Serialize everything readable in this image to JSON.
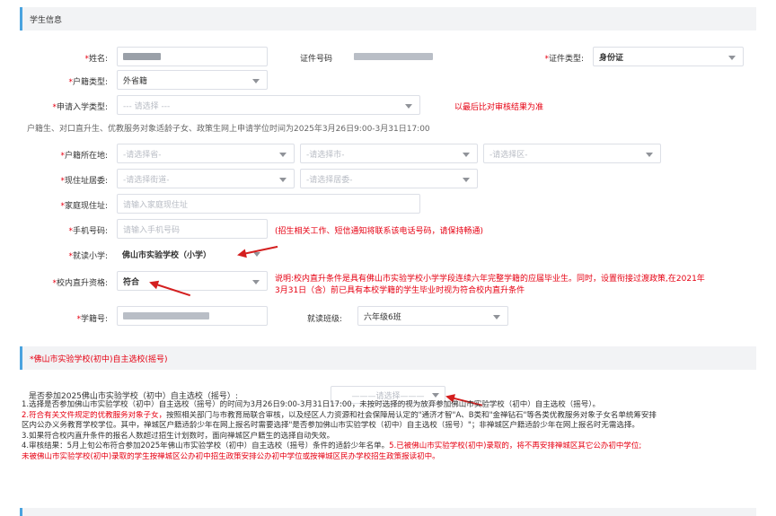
{
  "section1": {
    "title": "学生信息"
  },
  "fields": {
    "name_label": "姓名:",
    "id_no_label": "证件号码",
    "id_type_label": "证件类型:",
    "id_type_value": "身份证",
    "huji_label": "户籍类型:",
    "huji_value": "外省籍",
    "apply_type_label": "申请入学类型:",
    "apply_type_ph": "--- 请选择 ---",
    "apply_hint": "以最后比对审核结果为准",
    "apply_note": "户籍生、对口直升生、优教服务对象适龄子女、政策生网上申请学位时间为2025年3月26日9:00-3月31日17:00",
    "huji_loc_label": "户籍所在地:",
    "province_ph": "-请选择省-",
    "city_ph": "-请选择市-",
    "district_ph": "-请选择区-",
    "residence_label": "现住址居委:",
    "street_ph": "-请选择街道-",
    "committee_ph": "-请选择居委-",
    "address_label": "家庭现住址:",
    "address_ph": "请输入家庭现住址",
    "phone_label": "手机号码:",
    "phone_ph": "请输入手机号码",
    "phone_hint": "(招生相关工作、短信通知将联系该电话号码，请保持畅通)",
    "school_label": "就读小学:",
    "school_value": "佛山市实验学校（小学）",
    "direct_label": "校内直升资格:",
    "direct_value": "符合",
    "direct_hint1": "说明:校内直升条件是具有佛山市实验学校小学学段连续六年完整学籍的应届毕业生。同时，设置衔接过渡政策,在2021年",
    "direct_hint2": "3月31日（含）前已具有本校学籍的学生毕业时视为符合校内直升条件",
    "xueji_label": "学籍号:",
    "class_label": "就读班级:",
    "class_value": "六年级6班"
  },
  "section2": {
    "title": "*佛山市实验学校(初中)自主选校(摇号)",
    "question": "是否参加2025佛山市实验学校（初中）自主选校（摇号）:",
    "select_ph": "———请选择———"
  },
  "notes": {
    "n1": "1.选择是否参加佛山市实验学校（初中）自主选校（摇号）的时间为3月26日9:00-3月31日17:00，未按时选择的视为放弃参加佛山市实验学校（初中）自主选校（摇号）。",
    "n2a": "2.符合有关文件规定的优教服务对象子女，",
    "n2b": "按照相关部门与市教育局联合审核，以及经区人力资源和社会保障局认定的\"通济才智\"A、B类和\"金禅钻石\"等各类优教服务对象子女名单统筹安排",
    "n2c": "区内公办义务教育学校学位。其中，禅城区户籍适龄少年在网上报名时需要选择\"是否参加佛山市实验学校（初中）自主选校（摇号）\"；非禅城区户籍适龄少年在网上报名时无需选择。",
    "n3": "3.如果符合校内直升条件的报名人数超过招生计划数时，面向禅城区户籍生的选择自动失效。",
    "n4a": "4.审核结果：5月上旬公布符合参加2025年佛山市实验学校（初中）自主选校（摇号）条件的适龄少年名单。",
    "n4b": "5.已被佛山市实验学校(初中)录取的，将不再安排禅城区其它公办初中学位;",
    "n5": "未被佛山市实验学校(初中)录取的学生按禅城区公办初中招生政策安排公办初中学位或按禅城区民办学校招生政策报读初中。"
  }
}
